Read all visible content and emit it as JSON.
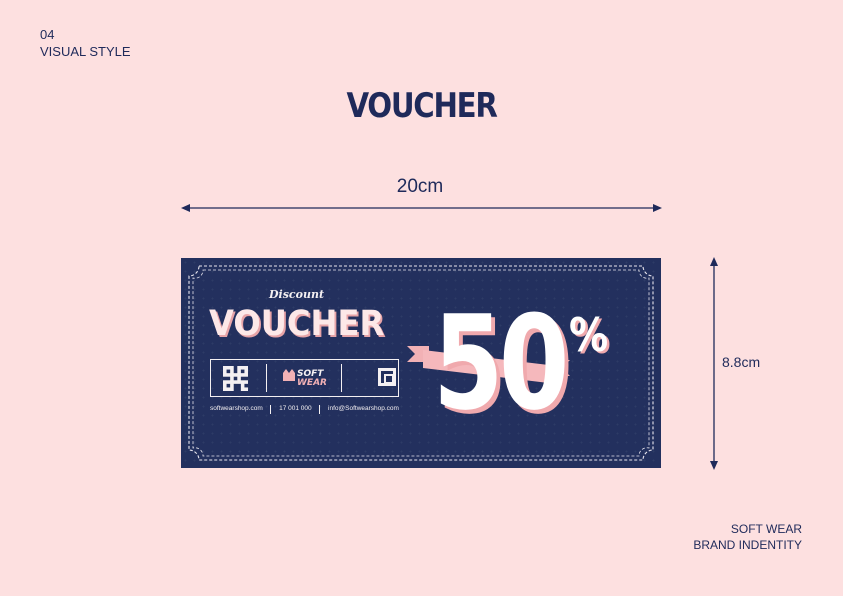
{
  "section": {
    "number": "04",
    "name": "VISUAL STYLE"
  },
  "title": "VOUCHER",
  "dimensions": {
    "width": "20cm",
    "height": "8.8cm"
  },
  "footer": {
    "line1": "SOFT WEAR",
    "line2": "BRAND INDENTITY"
  },
  "voucher": {
    "script_label": "Discount",
    "word": "VOUCHER",
    "amount": "50",
    "percent": "%",
    "logo": {
      "line1": "SOFT",
      "line2": "WEAR"
    },
    "contacts": {
      "website": "softwearshop.com",
      "phone": "17 001 000",
      "email": "info@Softwearshop.com"
    }
  },
  "colors": {
    "background": "#fde0e0",
    "navy": "#1f2a5a",
    "voucher_bg": "#23305e",
    "pink_accent": "#f2b1b5",
    "white": "#ffffff"
  }
}
